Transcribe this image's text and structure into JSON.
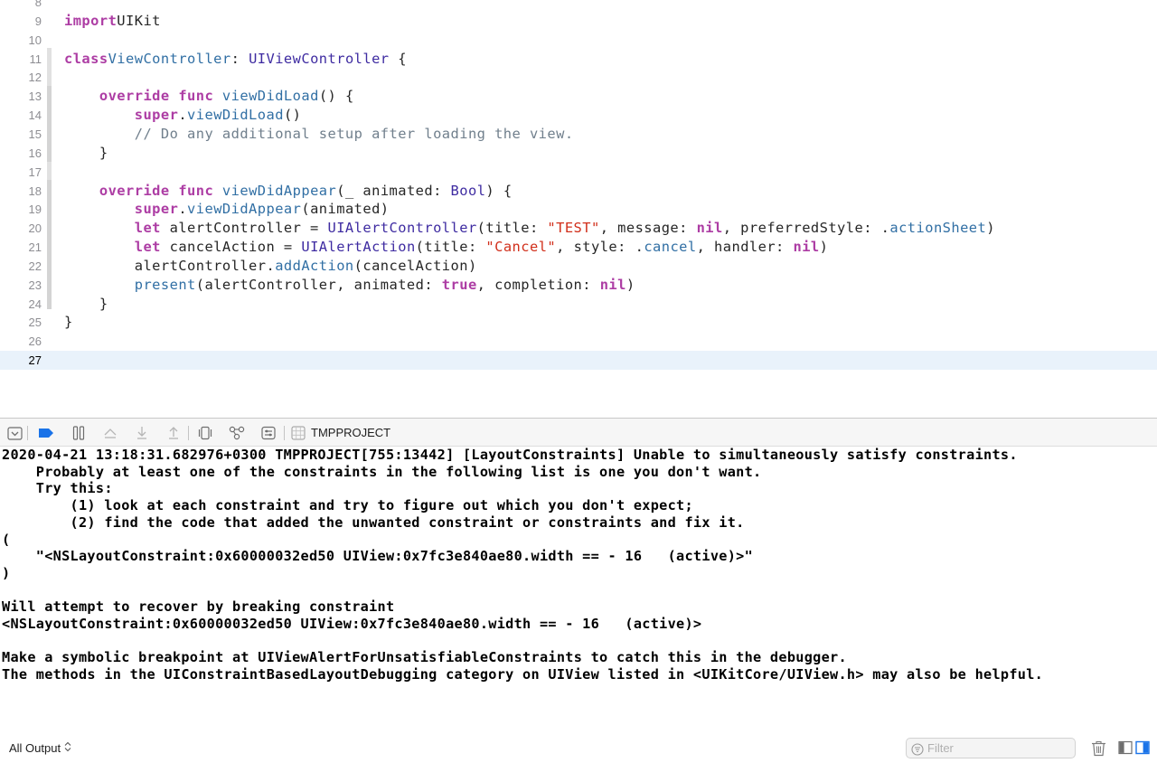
{
  "editor": {
    "current_line": 27,
    "lines": [
      {
        "num": "8",
        "tokens": []
      },
      {
        "num": "9",
        "tokens": [
          [
            "kw",
            "import"
          ],
          [
            "",
            "UIKit"
          ]
        ]
      },
      {
        "num": "10",
        "tokens": []
      },
      {
        "num": "11",
        "tokens": [
          [
            "kw",
            "class"
          ],
          [
            "",
            ""
          ],
          [
            "fn",
            "ViewController"
          ],
          [
            "",
            ": "
          ],
          [
            "ty",
            "UIViewController"
          ],
          [
            "",
            " {"
          ]
        ]
      },
      {
        "num": "12",
        "tokens": []
      },
      {
        "num": "13",
        "tokens": [
          [
            "",
            "    "
          ],
          [
            "kw",
            "override"
          ],
          [
            "",
            " "
          ],
          [
            "kw",
            "func"
          ],
          [
            "",
            " "
          ],
          [
            "fn",
            "viewDidLoad"
          ],
          [
            "",
            "() {"
          ]
        ]
      },
      {
        "num": "14",
        "tokens": [
          [
            "",
            "        "
          ],
          [
            "kw",
            "super"
          ],
          [
            "",
            "."
          ],
          [
            "mem",
            "viewDidLoad"
          ],
          [
            "",
            "()"
          ]
        ]
      },
      {
        "num": "15",
        "tokens": [
          [
            "",
            "        "
          ],
          [
            "cm",
            "// Do any additional setup after loading the view."
          ]
        ]
      },
      {
        "num": "16",
        "tokens": [
          [
            "",
            "    }"
          ]
        ]
      },
      {
        "num": "17",
        "tokens": []
      },
      {
        "num": "18",
        "tokens": [
          [
            "",
            "    "
          ],
          [
            "kw",
            "override"
          ],
          [
            "",
            " "
          ],
          [
            "kw",
            "func"
          ],
          [
            "",
            " "
          ],
          [
            "fn",
            "viewDidAppear"
          ],
          [
            "",
            "(_ animated: "
          ],
          [
            "ty",
            "Bool"
          ],
          [
            "",
            ") {"
          ]
        ]
      },
      {
        "num": "19",
        "tokens": [
          [
            "",
            "        "
          ],
          [
            "kw",
            "super"
          ],
          [
            "",
            "."
          ],
          [
            "mem",
            "viewDidAppear"
          ],
          [
            "",
            "(animated)"
          ]
        ]
      },
      {
        "num": "20",
        "tokens": [
          [
            "",
            "        "
          ],
          [
            "kw",
            "let"
          ],
          [
            "",
            " alertController = "
          ],
          [
            "ty",
            "UIAlertController"
          ],
          [
            "",
            "(title: "
          ],
          [
            "str",
            "\"TEST\""
          ],
          [
            "",
            ", message: "
          ],
          [
            "kw",
            "nil"
          ],
          [
            "",
            ", preferredStyle: ."
          ],
          [
            "mem",
            "actionSheet"
          ],
          [
            "",
            ")"
          ]
        ]
      },
      {
        "num": "21",
        "tokens": [
          [
            "",
            "        "
          ],
          [
            "kw",
            "let"
          ],
          [
            "",
            " cancelAction = "
          ],
          [
            "ty",
            "UIAlertAction"
          ],
          [
            "",
            "(title: "
          ],
          [
            "str",
            "\"Cancel\""
          ],
          [
            "",
            ", style: ."
          ],
          [
            "mem",
            "cancel"
          ],
          [
            "",
            ", handler: "
          ],
          [
            "kw",
            "nil"
          ],
          [
            "",
            ")"
          ]
        ]
      },
      {
        "num": "22",
        "tokens": [
          [
            "",
            "        alertController."
          ],
          [
            "mem",
            "addAction"
          ],
          [
            "",
            "(cancelAction)"
          ]
        ]
      },
      {
        "num": "23",
        "tokens": [
          [
            "",
            "        "
          ],
          [
            "mem",
            "present"
          ],
          [
            "",
            "(alertController, animated: "
          ],
          [
            "kw",
            "true"
          ],
          [
            "",
            ", completion: "
          ],
          [
            "kw",
            "nil"
          ],
          [
            "",
            ")"
          ]
        ]
      },
      {
        "num": "24",
        "tokens": [
          [
            "",
            "    }"
          ]
        ]
      },
      {
        "num": "25",
        "tokens": [
          [
            "",
            "}"
          ]
        ]
      },
      {
        "num": "26",
        "tokens": []
      },
      {
        "num": "27",
        "tokens": []
      }
    ]
  },
  "debug_toolbar": {
    "project_label": "TMPPROJECT",
    "icons": [
      "hide-debug-area-icon",
      "breakpoints-toggle-icon",
      "pause-icon",
      "step-over-icon",
      "step-into-icon",
      "step-out-icon",
      "view-debugger-icon",
      "memory-graph-icon",
      "environment-overrides-icon",
      "project-target-icon"
    ]
  },
  "console": {
    "text": "2020-04-21 13:18:31.682976+0300 TMPPROJECT[755:13442] [LayoutConstraints] Unable to simultaneously satisfy constraints.\n    Probably at least one of the constraints in the following list is one you don't want. \n    Try this: \n        (1) look at each constraint and try to figure out which you don't expect; \n        (2) find the code that added the unwanted constraint or constraints and fix it. \n(\n    \"<NSLayoutConstraint:0x60000032ed50 UIView:0x7fc3e840ae80.width == - 16   (active)>\"\n)\n\nWill attempt to recover by breaking constraint \n<NSLayoutConstraint:0x60000032ed50 UIView:0x7fc3e840ae80.width == - 16   (active)>\n\nMake a symbolic breakpoint at UIViewAlertForUnsatisfiableConstraints to catch this in the debugger.\nThe methods in the UIConstraintBasedLayoutDebugging category on UIView listed in <UIKitCore/UIView.h> may also be helpful."
  },
  "bottom_bar": {
    "output_selector": "All Output",
    "filter_placeholder": "Filter",
    "filter_value": "",
    "icons": [
      "trash-icon",
      "show-variables-view-icon",
      "show-console-view-icon"
    ]
  },
  "colors": {
    "keyword": "#ad3da4",
    "type": "#3e2ba1",
    "function": "#316fa4",
    "string": "#d12f1b",
    "comment": "#707f8c",
    "accent": "#1a73e8",
    "current_line": "#e9f2fb"
  }
}
